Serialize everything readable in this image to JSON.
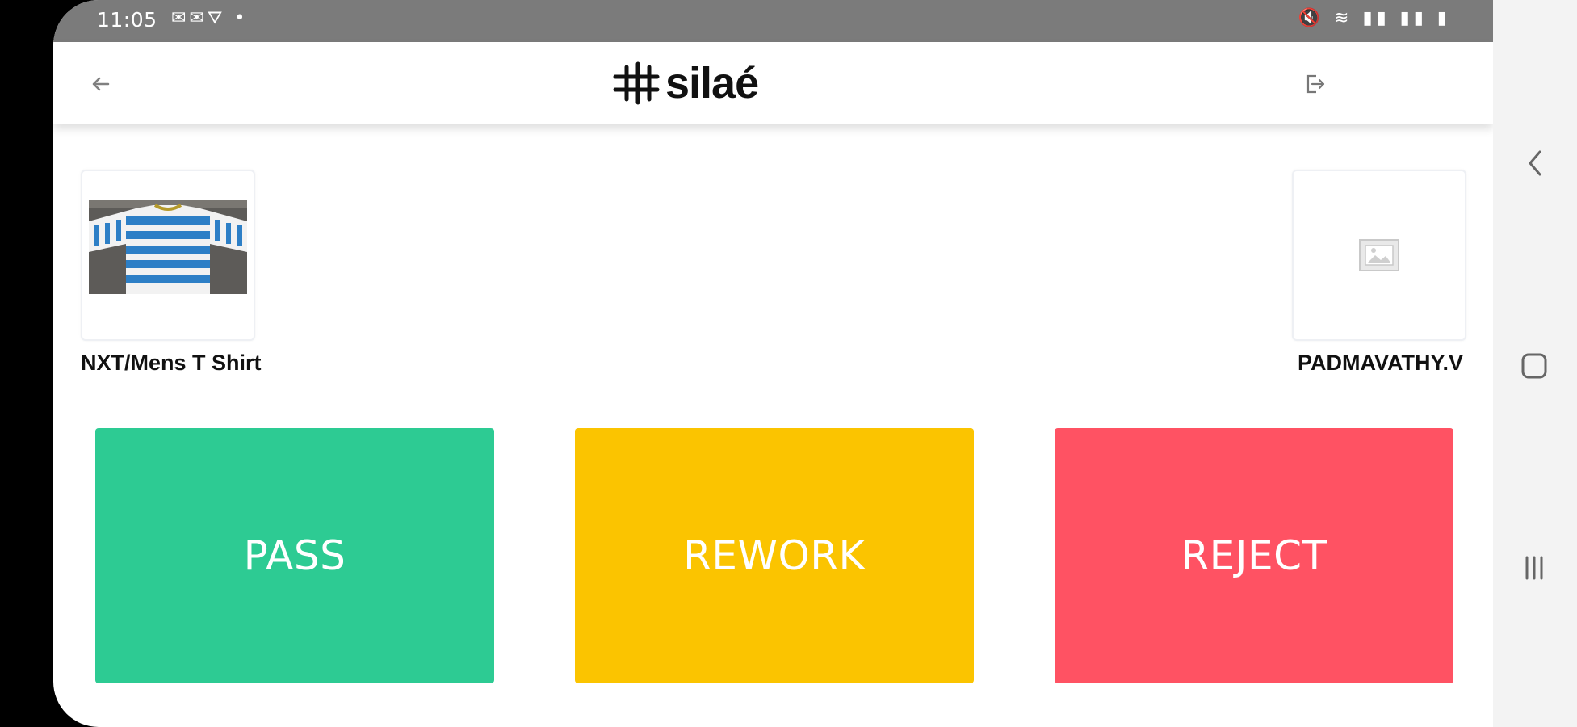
{
  "status_bar": {
    "time": "11:05",
    "left_icons": [
      "mail-icon",
      "mail-icon",
      "drive-icon",
      "dot-icon"
    ],
    "left_icons_text": "✉✉⛛ •",
    "right_icons": [
      "mute-icon",
      "wifi-icon",
      "signal-icon",
      "signal-icon",
      "battery-icon"
    ],
    "right_icons_text": "🔇 ≋ ▮▮ ▮▮ ▮"
  },
  "header": {
    "logo_text": "silaé",
    "back_icon": "arrow-left-icon",
    "logout_icon": "logout-icon"
  },
  "product": {
    "name": "NXT/Mens T Shirt",
    "image": "striped-tshirt-photo"
  },
  "operator": {
    "name": "PADMAVATHY.V",
    "image": "image-placeholder-icon"
  },
  "actions": {
    "pass": "PASS",
    "rework": "REWORK",
    "reject": "REJECT"
  },
  "colors": {
    "pass": "#2dcb93",
    "rework": "#fbc400",
    "reject": "#ff5263",
    "status_bar": "#7b7b7b"
  },
  "nav_bar": [
    "back-icon",
    "home-icon",
    "recents-icon"
  ]
}
